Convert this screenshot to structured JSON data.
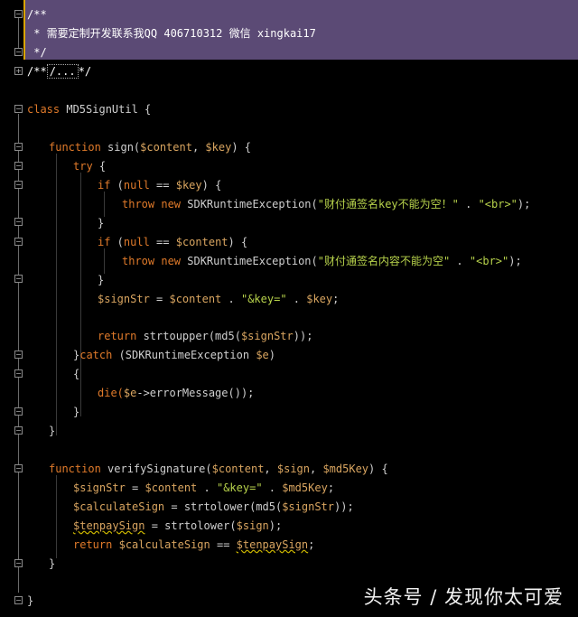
{
  "code": {
    "l1": "/**",
    "l2": " * 需要定制开发联系我QQ 406710312 微信 xingkai17",
    "l3": " */",
    "l4a": "/**",
    "l4b": "/...",
    "l4c": "*/",
    "l5a": "class",
    "l5b": " MD5SignUtil {",
    "l6a": "function",
    "l6b": " sign(",
    "l6c": "$content",
    "l6d": ", ",
    "l6e": "$key",
    "l6f": ") {",
    "l7a": "try",
    "l7b": " {",
    "l8a": "if",
    "l8b": " (",
    "l8c": "null",
    "l8d": " == ",
    "l8e": "$key",
    "l8f": ") {",
    "l9a": "throw new",
    "l9b": " SDKRuntimeException(",
    "l9c": "\"财付通签名key不能为空！\"",
    "l9d": " . ",
    "l9e": "\"<br>\"",
    "l9f": ");",
    "l10": "}",
    "l11a": "if",
    "l11b": " (",
    "l11c": "null",
    "l11d": " == ",
    "l11e": "$content",
    "l11f": ") {",
    "l12a": "throw new",
    "l12b": " SDKRuntimeException(",
    "l12c": "\"财付通签名内容不能为空\"",
    "l12d": " . ",
    "l12e": "\"<br>\"",
    "l12f": ");",
    "l13": "}",
    "l14a": "$signStr",
    "l14b": " = ",
    "l14c": "$content",
    "l14d": " . ",
    "l14e": "\"&key=\"",
    "l14f": " . ",
    "l14g": "$key",
    "l14h": ";",
    "l15a": "return",
    "l15b": " strtoupper(md5(",
    "l15c": "$signStr",
    "l15d": "));",
    "l16a": "}",
    "l16b": "catch",
    "l16c": " (SDKRuntimeException ",
    "l16d": "$e",
    "l16e": ")",
    "l17": "{",
    "l18a": "die(",
    "l18b": "$e",
    "l18c": "->errorMessage());",
    "l19": "}",
    "l20": "}",
    "l21a": "function",
    "l21b": " verifySignature(",
    "l21c": "$content",
    "l21d": ", ",
    "l21e": "$sign",
    "l21f": ", ",
    "l21g": "$md5Key",
    "l21h": ") {",
    "l22a": "$signStr",
    "l22b": " = ",
    "l22c": "$content",
    "l22d": " . ",
    "l22e": "\"&key=\"",
    "l22f": " . ",
    "l22g": "$md5Key",
    "l22h": ";",
    "l23a": "$calculateSign",
    "l23b": " = strtolower(md5(",
    "l23c": "$signStr",
    "l23d": "));",
    "l24a": "$tenpaySign",
    "l24b": " = strtolower(",
    "l24c": "$sign",
    "l24d": ");",
    "l25a": "return",
    "l25b": " ",
    "l25c": "$calculateSign",
    "l25d": " == ",
    "l25e": "$tenpaySign",
    "l25f": ";",
    "l26": "}",
    "l27": "}"
  },
  "watermark": "头条号 / 发现你太可爱",
  "colors": {
    "background": "#000000",
    "comment_highlight": "#5b4a75",
    "keyword": "#e07a2a",
    "variable": "#d9a560",
    "string": "#b7d24b",
    "caret": "#d9a400"
  }
}
